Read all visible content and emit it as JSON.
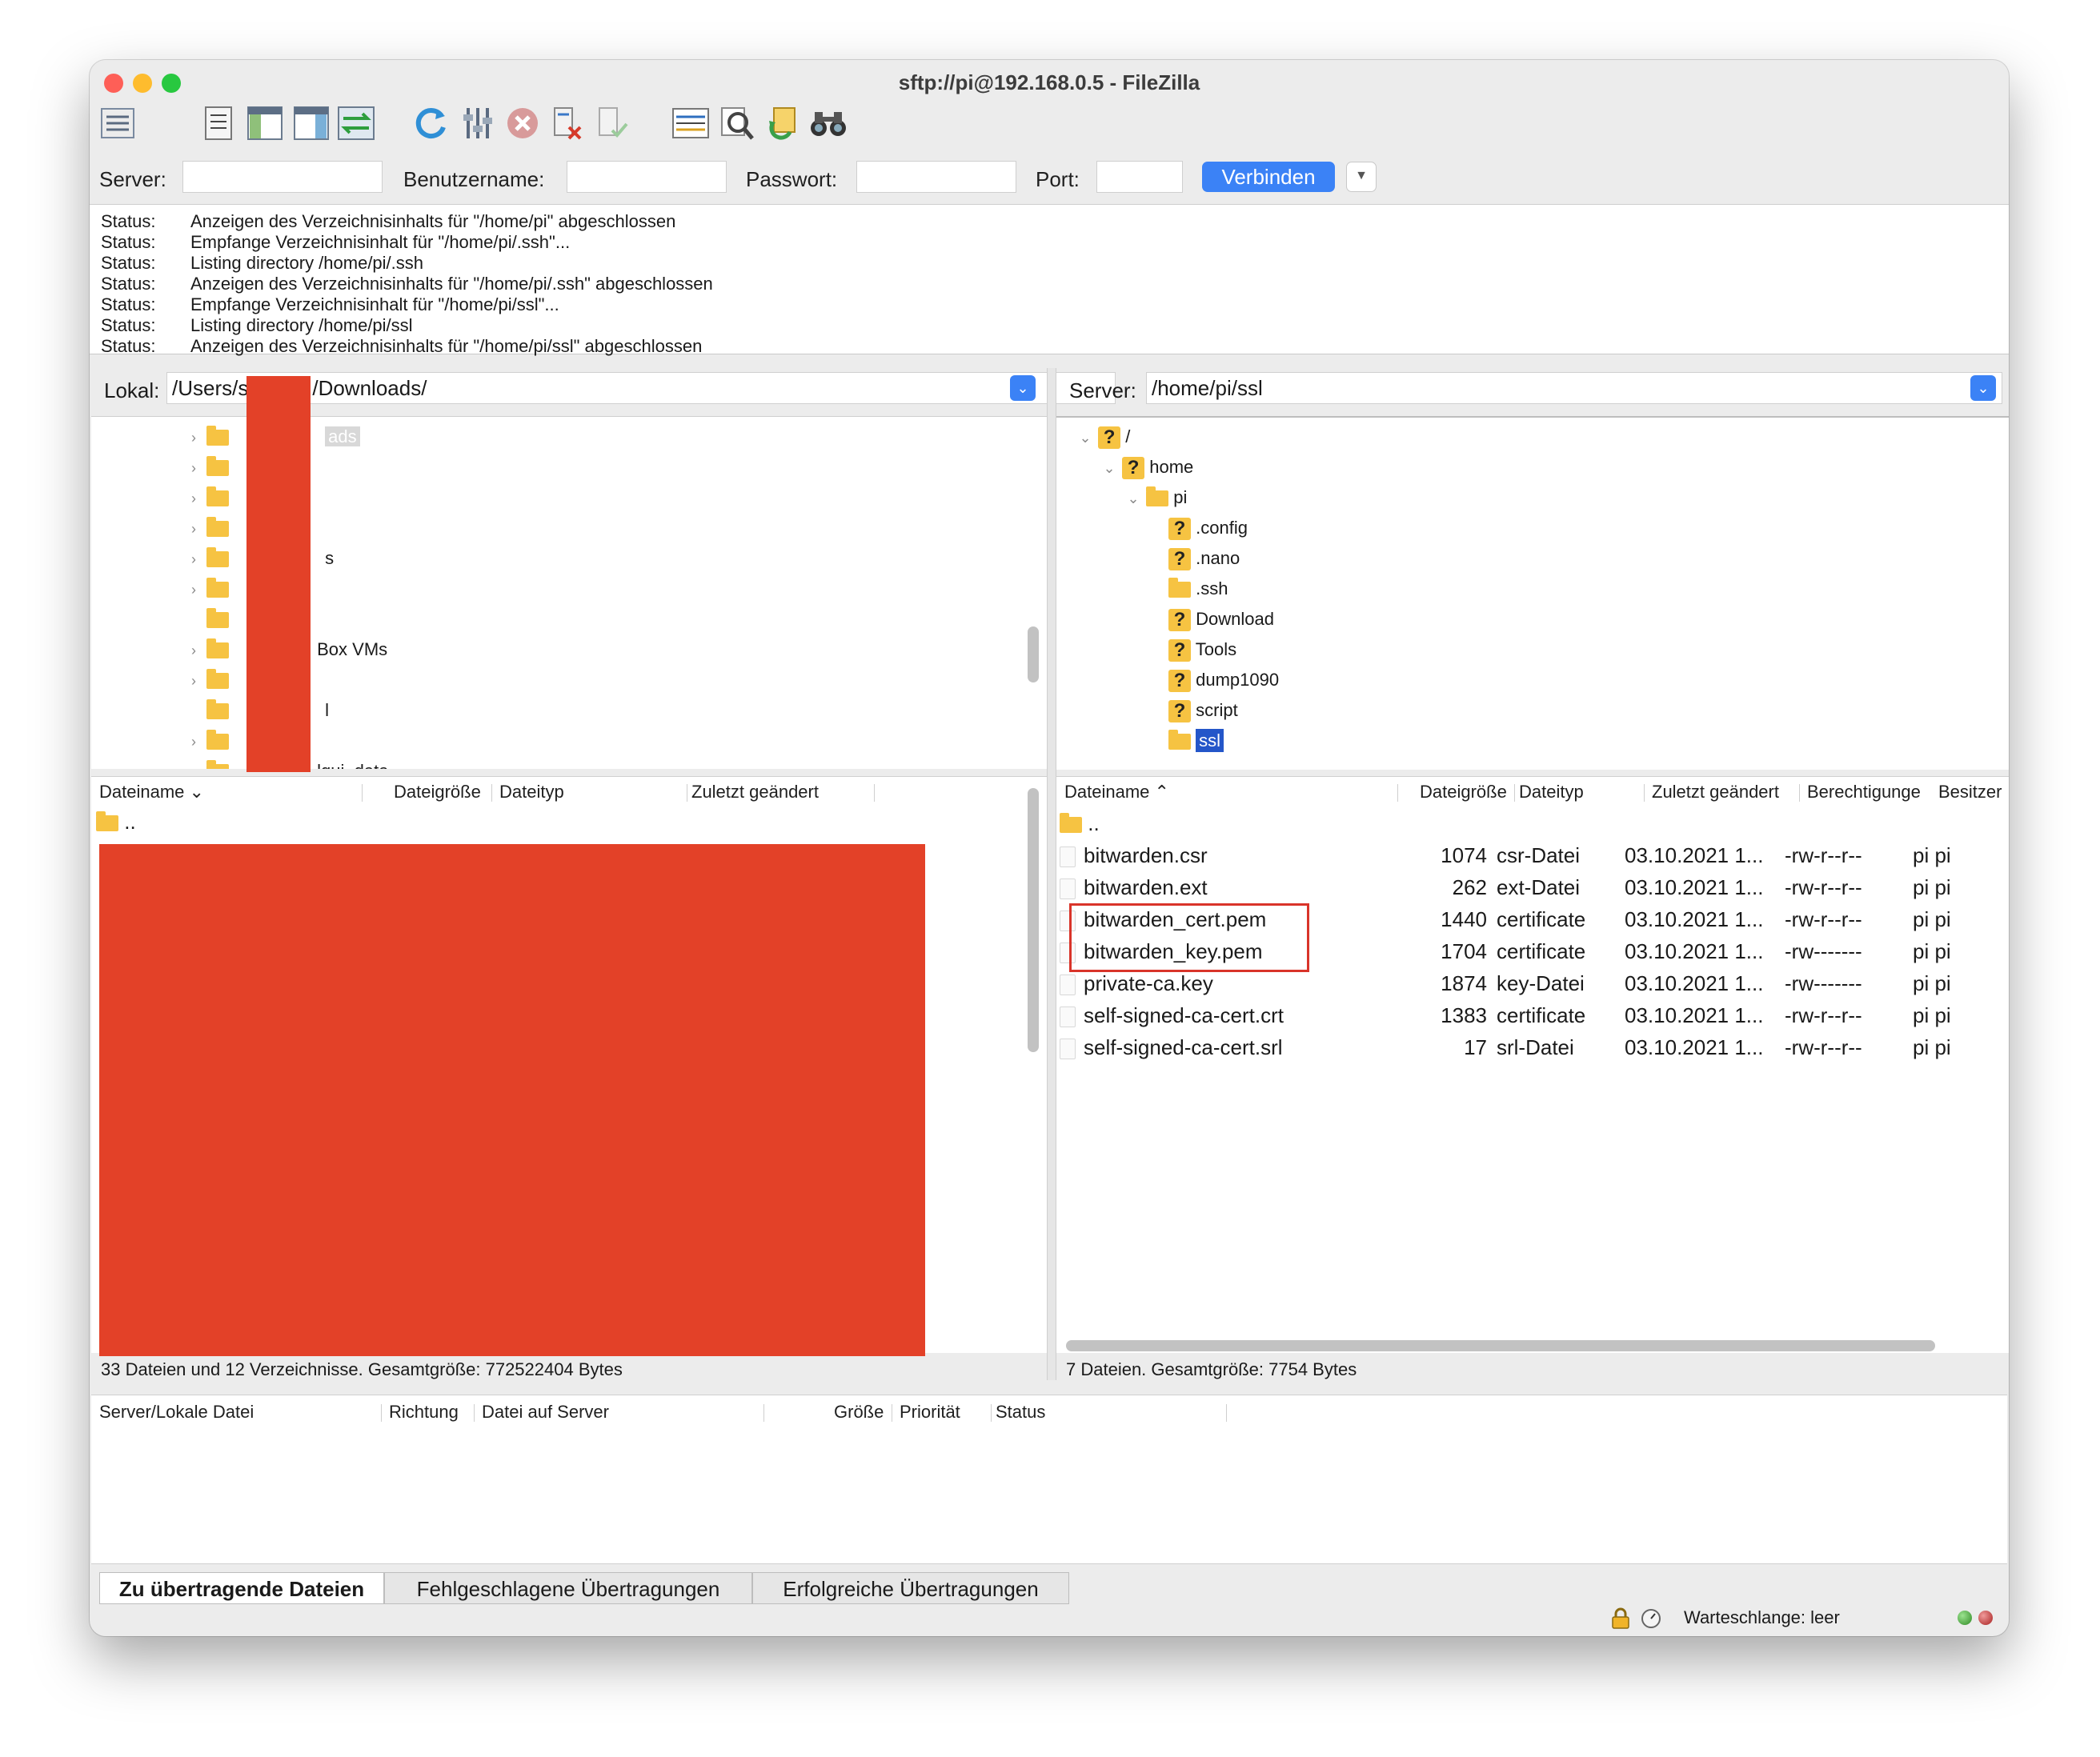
{
  "window": {
    "title": "sftp://pi@192.168.0.5 - FileZilla"
  },
  "toolbar": {
    "icons": [
      "site-manager-icon",
      "toggle-log-icon",
      "toggle-local-tree-icon",
      "toggle-remote-tree-icon",
      "toggle-transfer-queue-icon",
      "refresh-icon",
      "process-queue-icon",
      "cancel-icon",
      "disconnect-icon",
      "reconnect-icon",
      "filter-icon",
      "compare-icon",
      "sync-browse-icon",
      "search-icon"
    ]
  },
  "quickconnect": {
    "server_label": "Server:",
    "user_label": "Benutzername:",
    "pass_label": "Passwort:",
    "port_label": "Port:",
    "connect_label": "Verbinden",
    "server_value": "",
    "user_value": "",
    "pass_value": "",
    "port_value": ""
  },
  "log": [
    {
      "k": "Status:",
      "v": "Anzeigen des Verzeichnisinhalts für \"/home/pi\" abgeschlossen"
    },
    {
      "k": "Status:",
      "v": "Empfange Verzeichnisinhalt für \"/home/pi/.ssh\"..."
    },
    {
      "k": "Status:",
      "v": "Listing directory /home/pi/.ssh"
    },
    {
      "k": "Status:",
      "v": "Anzeigen des Verzeichnisinhalts für \"/home/pi/.ssh\" abgeschlossen"
    },
    {
      "k": "Status:",
      "v": "Empfange Verzeichnisinhalt für \"/home/pi/ssl\"..."
    },
    {
      "k": "Status:",
      "v": "Listing directory /home/pi/ssl"
    },
    {
      "k": "Status:",
      "v": "Anzeigen des Verzeichnisinhalts für \"/home/pi/ssl\" abgeschlossen"
    }
  ],
  "local": {
    "label": "Lokal:",
    "path_prefix": "/Users/s",
    "path_suffix": "/Downloads/",
    "tree": [
      {
        "name": "ads",
        "expander": true
      },
      {
        "name": "",
        "expander": true
      },
      {
        "name": "",
        "expander": true
      },
      {
        "name": "",
        "expander": true
      },
      {
        "name": "s",
        "expander": true
      },
      {
        "name": "",
        "expander": true
      },
      {
        "name": "",
        "expander": false
      },
      {
        "name": "Box VMs",
        "expander": true
      },
      {
        "name": "",
        "expander": true
      },
      {
        "name": "l",
        "expander": false
      },
      {
        "name": "",
        "expander": true
      },
      {
        "name": "lqui_data",
        "expander": true
      }
    ],
    "columns": {
      "name": "Dateiname",
      "size": "Dateigröße",
      "type": "Dateityp",
      "modified": "Zuletzt geändert"
    },
    "parent": "..",
    "status": "33 Dateien und 12 Verzeichnisse. Gesamtgröße: 772522404 Bytes"
  },
  "remote": {
    "label": "Server:",
    "path": "/home/pi/ssl",
    "tree": [
      {
        "name": "/",
        "icon": "unknown",
        "level": 0,
        "expander": "open"
      },
      {
        "name": "home",
        "icon": "unknown",
        "level": 1,
        "expander": "open"
      },
      {
        "name": "pi",
        "icon": "folder",
        "level": 2,
        "expander": "open"
      },
      {
        "name": ".config",
        "icon": "unknown",
        "level": 3,
        "expander": ""
      },
      {
        "name": ".nano",
        "icon": "unknown",
        "level": 3,
        "expander": ""
      },
      {
        "name": ".ssh",
        "icon": "folder",
        "level": 3,
        "expander": ""
      },
      {
        "name": "Download",
        "icon": "unknown",
        "level": 3,
        "expander": ""
      },
      {
        "name": "Tools",
        "icon": "unknown",
        "level": 3,
        "expander": ""
      },
      {
        "name": "dump1090",
        "icon": "unknown",
        "level": 3,
        "expander": ""
      },
      {
        "name": "script",
        "icon": "unknown",
        "level": 3,
        "expander": ""
      },
      {
        "name": "ssl",
        "icon": "folder",
        "level": 3,
        "expander": "",
        "selected": true
      }
    ],
    "columns": {
      "name": "Dateiname",
      "size": "Dateigröße",
      "type": "Dateityp",
      "modified": "Zuletzt geändert",
      "perms": "Berechtigunge",
      "owner": "Besitzer"
    },
    "parent": "..",
    "files": [
      {
        "name": "bitwarden.csr",
        "size": "1074",
        "type": "csr-Datei",
        "modified": "03.10.2021 1...",
        "perms": "-rw-r--r--",
        "owner": "pi pi"
      },
      {
        "name": "bitwarden.ext",
        "size": "262",
        "type": "ext-Datei",
        "modified": "03.10.2021 1...",
        "perms": "-rw-r--r--",
        "owner": "pi pi"
      },
      {
        "name": "bitwarden_cert.pem",
        "size": "1440",
        "type": "certificate",
        "modified": "03.10.2021 1...",
        "perms": "-rw-r--r--",
        "owner": "pi pi"
      },
      {
        "name": "bitwarden_key.pem",
        "size": "1704",
        "type": "certificate",
        "modified": "03.10.2021 1...",
        "perms": "-rw-------",
        "owner": "pi pi"
      },
      {
        "name": "private-ca.key",
        "size": "1874",
        "type": "key-Datei",
        "modified": "03.10.2021 1...",
        "perms": "-rw-------",
        "owner": "pi pi"
      },
      {
        "name": "self-signed-ca-cert.crt",
        "size": "1383",
        "type": "certificate",
        "modified": "03.10.2021 1...",
        "perms": "-rw-r--r--",
        "owner": "pi pi"
      },
      {
        "name": "self-signed-ca-cert.srl",
        "size": "17",
        "type": "srl-Datei",
        "modified": "03.10.2021 1...",
        "perms": "-rw-r--r--",
        "owner": "pi pi"
      }
    ],
    "status": "7 Dateien. Gesamtgröße: 7754 Bytes"
  },
  "queue": {
    "columns": {
      "file": "Server/Lokale Datei",
      "dir": "Richtung",
      "remote": "Datei auf Server",
      "size": "Größe",
      "prio": "Priorität",
      "status": "Status"
    },
    "tabs": [
      "Zu übertragende Dateien",
      "Fehlgeschlagene Übertragungen",
      "Erfolgreiche Übertragungen"
    ],
    "queue_status": "Warteschlange: leer"
  },
  "colors": {
    "redaction": "#e34128",
    "highlight_box": "#d9342a",
    "accent": "#3b82f6",
    "selection": "#2456c9"
  }
}
